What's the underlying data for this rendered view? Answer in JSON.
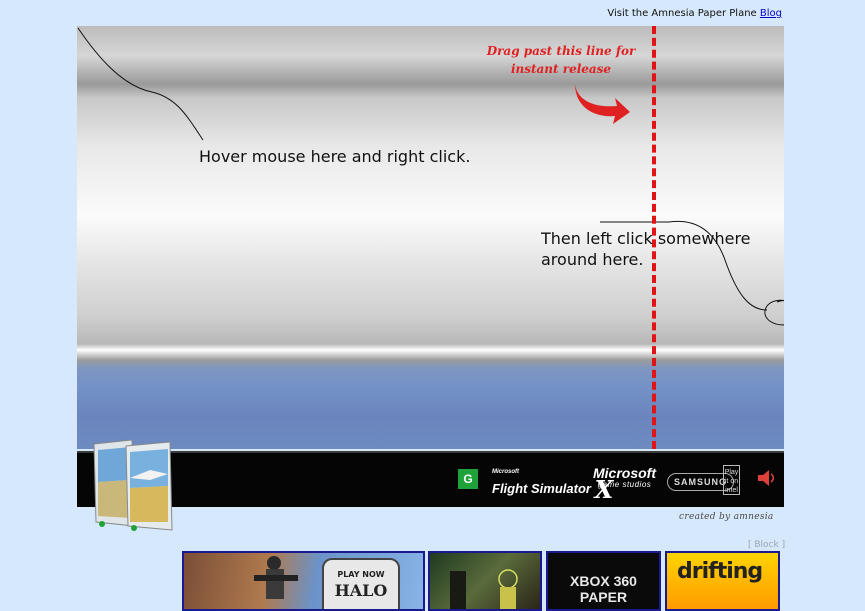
{
  "header": {
    "visit_text": "Visit the Amnesia Paper Plane",
    "blog_link": "Blog"
  },
  "stage": {
    "instruction_right_click": "Hover mouse here and right click.",
    "instruction_left_click": "Then left click somewhere around here.",
    "drag_label_line1": "Drag past this line for",
    "drag_label_line2": "instant release"
  },
  "sponsors": {
    "rating_badge": "G",
    "flight_sim_prefix": "Microsoft",
    "flight_sim": "Flight Simulator",
    "flight_sim_x": "X",
    "microsoft": "Microsoft",
    "microsoft_sub": "game studios",
    "samsung": "SAMSUNG",
    "intel": "Play it on intel"
  },
  "credit": "created by amnesia",
  "block_link": "[ Block ]",
  "thumbnails": [
    {
      "name": "halo",
      "play_label": "PLAY NOW",
      "title": "HALO"
    },
    {
      "name": "shooter"
    },
    {
      "name": "xbox-paper",
      "title_line1": "XBOX 360",
      "title_line2": "PAPER"
    },
    {
      "name": "drifting",
      "title": "drifting"
    }
  ],
  "colors": {
    "page_background": "#d6e8fb",
    "release_line": "#e01414",
    "link": "#0000cc",
    "sponsor_bar": "#050505",
    "thumb_border": "#1a1a8e"
  },
  "icons": {
    "audio": "speaker-icon",
    "rating": "rating-g-icon"
  }
}
